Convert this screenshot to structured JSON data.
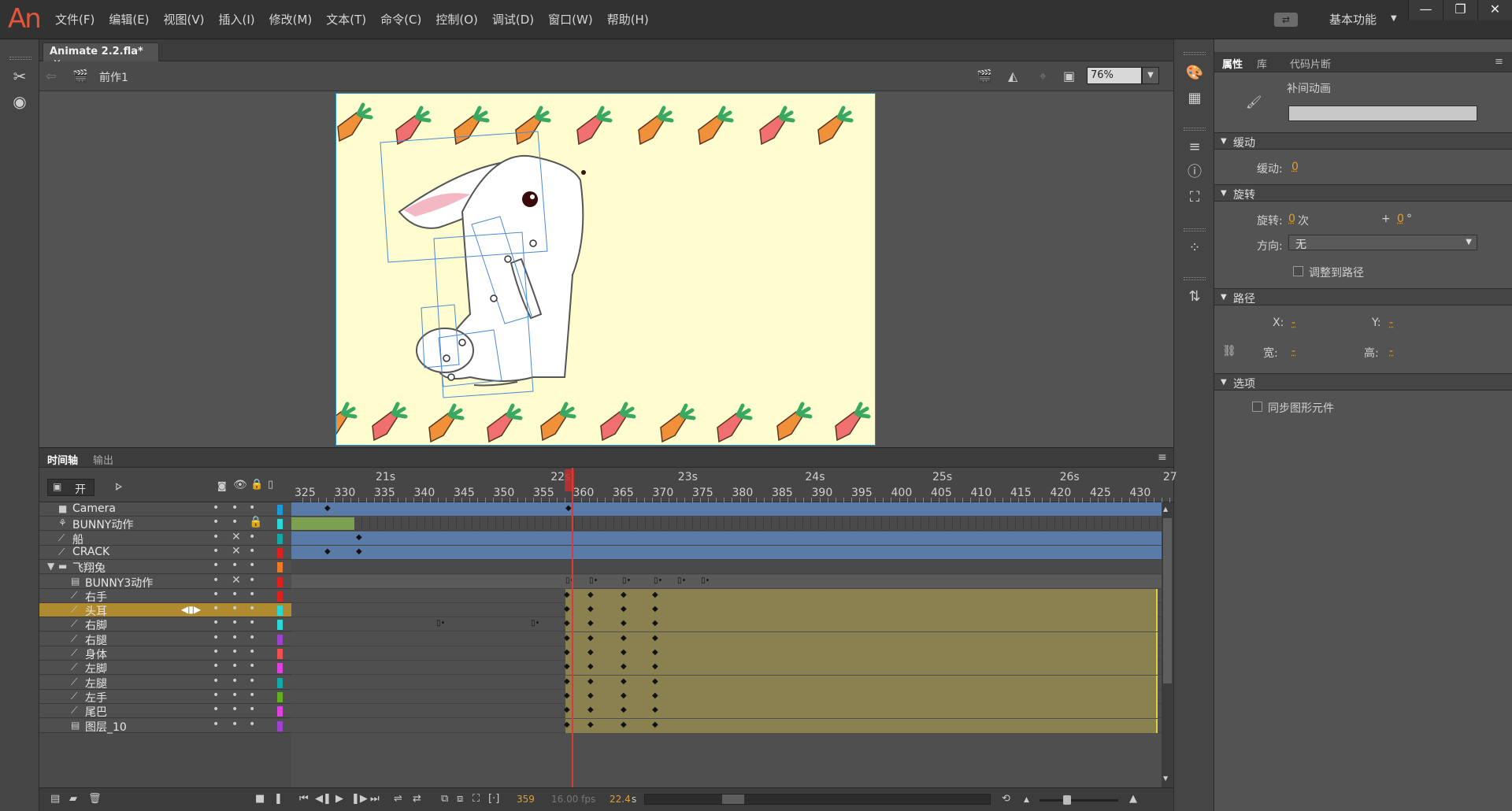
{
  "app": {
    "logo": "An"
  },
  "menu": [
    "文件(F)",
    "编辑(E)",
    "视图(V)",
    "插入(I)",
    "修改(M)",
    "文本(T)",
    "命令(C)",
    "控制(O)",
    "调试(D)",
    "窗口(W)",
    "帮助(H)"
  ],
  "workspace": {
    "label": "基本功能"
  },
  "window_controls": {
    "minimize": "—",
    "restore": "❐",
    "close": "✕"
  },
  "document": {
    "tab": "Animate 2.2.fla*",
    "tab_close": "×"
  },
  "scene": {
    "name": "前作1",
    "zoom": "76%"
  },
  "timeline": {
    "tabs": [
      "时间轴",
      "输出"
    ],
    "toggle_label": "开",
    "ruler_seconds": [
      {
        "label": "21s",
        "frame": 335
      },
      {
        "label": "22s",
        "frame": 357
      },
      {
        "label": "23s",
        "frame": 373
      },
      {
        "label": "24s",
        "frame": 389
      },
      {
        "label": "25s",
        "frame": 405
      },
      {
        "label": "26s",
        "frame": 421
      },
      {
        "label": "27",
        "frame": 434
      }
    ],
    "ruler_frames": [
      "325",
      "330",
      "335",
      "340",
      "345",
      "350",
      "355",
      "360",
      "365",
      "370",
      "375",
      "380",
      "385",
      "390",
      "395",
      "400",
      "405",
      "410",
      "415",
      "420",
      "425",
      "430"
    ],
    "layers": [
      {
        "name": "Camera",
        "icon": "camera-icon",
        "indent": 0,
        "color": "#1a9ad8",
        "lock": false,
        "hidden": false
      },
      {
        "name": "BUNNY动作",
        "icon": "run-icon",
        "indent": 0,
        "color": "#2ad8d8",
        "lock": true,
        "hidden": false
      },
      {
        "name": "船",
        "icon": "motion-icon",
        "indent": 0,
        "color": "#13a8a8",
        "lock": false,
        "hidden": true
      },
      {
        "name": "CRACK",
        "icon": "motion-icon",
        "indent": 0,
        "color": "#e02020",
        "lock": false,
        "hidden": true
      },
      {
        "name": "飞翔兔",
        "icon": "folder-icon",
        "indent": 0,
        "color": "#f07820",
        "lock": false,
        "hidden": false
      },
      {
        "name": "BUNNY3动作",
        "icon": "layer-icon",
        "indent": 1,
        "color": "#e02020",
        "lock": false,
        "hidden": true
      },
      {
        "name": "右手",
        "icon": "motion-icon",
        "indent": 1,
        "color": "#e02020",
        "lock": false,
        "hidden": false
      },
      {
        "name": "头耳",
        "icon": "motion-icon",
        "indent": 1,
        "color": "#2ad8d8",
        "lock": false,
        "hidden": false,
        "selected": true
      },
      {
        "name": "右脚",
        "icon": "motion-icon",
        "indent": 1,
        "color": "#2ad8d8",
        "lock": false,
        "hidden": false
      },
      {
        "name": "右腿",
        "icon": "motion-icon",
        "indent": 1,
        "color": "#a040d0",
        "lock": false,
        "hidden": false
      },
      {
        "name": "身体",
        "icon": "motion-icon",
        "indent": 1,
        "color": "#f05050",
        "lock": false,
        "hidden": false
      },
      {
        "name": "左脚",
        "icon": "motion-icon",
        "indent": 1,
        "color": "#e040e0",
        "lock": false,
        "hidden": false
      },
      {
        "name": "左腿",
        "icon": "motion-icon",
        "indent": 1,
        "color": "#13a8a8",
        "lock": false,
        "hidden": false
      },
      {
        "name": "左手",
        "icon": "motion-icon",
        "indent": 1,
        "color": "#60b020",
        "lock": false,
        "hidden": false
      },
      {
        "name": "尾巴",
        "icon": "motion-icon",
        "indent": 1,
        "color": "#e040e0",
        "lock": false,
        "hidden": false
      },
      {
        "name": "图层_10",
        "icon": "layer-icon",
        "indent": 1,
        "color": "#a040d0",
        "lock": false,
        "hidden": false
      }
    ],
    "current_frame": "359",
    "fps": "16.00 fps",
    "time": "22.4",
    "time_unit": "s"
  },
  "properties": {
    "tabs": [
      "属性",
      "库",
      "代码片断"
    ],
    "type": "补间动画",
    "sections": {
      "ease": "缓动",
      "rotate": "旋转",
      "path": "路径",
      "options": "选项"
    },
    "ease_label": "缓动:",
    "ease_value": "0",
    "rotate_label": "旋转:",
    "rotate_times": "0",
    "rotate_times_unit": "次",
    "rotate_plus": "+",
    "rotate_degrees": "0",
    "rotate_degree_unit": "°",
    "direction_label": "方向:",
    "direction_value": "无",
    "orient_to_path": "调整到路径",
    "x_label": "X:",
    "x_value": "-",
    "y_label": "Y:",
    "y_value": "-",
    "w_label": "宽:",
    "w_value": "-",
    "h_label": "高:",
    "h_value": "-",
    "sync_symbols": "同步图形元件"
  }
}
